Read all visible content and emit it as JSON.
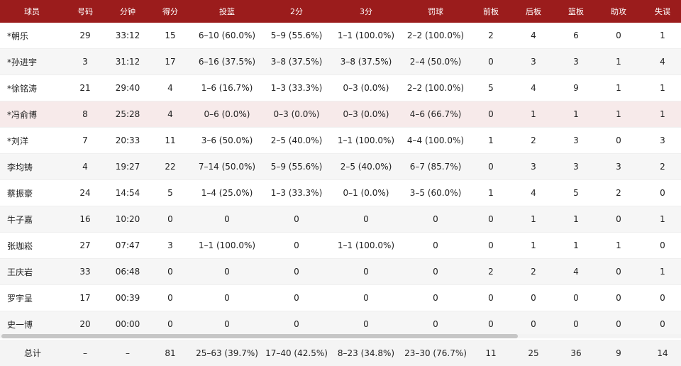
{
  "headers": [
    "球员",
    "号码",
    "分钟",
    "得分",
    "投篮",
    "2分",
    "3分",
    "罚球",
    "前板",
    "后板",
    "篮板",
    "助攻",
    "失误"
  ],
  "players": [
    {
      "name": "*朝乐",
      "number": "29",
      "minutes": "33:12",
      "points": "15",
      "fg": "6–10 (60.0%)",
      "two": "5–9 (55.6%)",
      "three": "1–1 (100.0%)",
      "ft": "2–2 (100.0%)",
      "oreb": "2",
      "dreb": "4",
      "reb": "6",
      "ast": "0",
      "tov": "1"
    },
    {
      "name": "*孙进宇",
      "number": "3",
      "minutes": "31:12",
      "points": "17",
      "fg": "6–16 (37.5%)",
      "two": "3–8 (37.5%)",
      "three": "3–8 (37.5%)",
      "ft": "2–4 (50.0%)",
      "oreb": "0",
      "dreb": "3",
      "reb": "3",
      "ast": "1",
      "tov": "4"
    },
    {
      "name": "*徐铭涛",
      "number": "21",
      "minutes": "29:40",
      "points": "4",
      "fg": "1–6 (16.7%)",
      "two": "1–3 (33.3%)",
      "three": "0–3 (0.0%)",
      "ft": "2–2 (100.0%)",
      "oreb": "5",
      "dreb": "4",
      "reb": "9",
      "ast": "1",
      "tov": "1"
    },
    {
      "name": "*冯俞博",
      "number": "8",
      "minutes": "25:28",
      "points": "4",
      "fg": "0–6 (0.0%)",
      "two": "0–3 (0.0%)",
      "three": "0–3 (0.0%)",
      "ft": "4–6 (66.7%)",
      "oreb": "0",
      "dreb": "1",
      "reb": "1",
      "ast": "1",
      "tov": "1"
    },
    {
      "name": "*刘洋",
      "number": "7",
      "minutes": "20:33",
      "points": "11",
      "fg": "3–6 (50.0%)",
      "two": "2–5 (40.0%)",
      "three": "1–1 (100.0%)",
      "ft": "4–4 (100.0%)",
      "oreb": "1",
      "dreb": "2",
      "reb": "3",
      "ast": "0",
      "tov": "3"
    },
    {
      "name": "李均铸",
      "number": "4",
      "minutes": "19:27",
      "points": "22",
      "fg": "7–14 (50.0%)",
      "two": "5–9 (55.6%)",
      "three": "2–5 (40.0%)",
      "ft": "6–7 (85.7%)",
      "oreb": "0",
      "dreb": "3",
      "reb": "3",
      "ast": "3",
      "tov": "2"
    },
    {
      "name": "蔡振豪",
      "number": "24",
      "minutes": "14:54",
      "points": "5",
      "fg": "1–4 (25.0%)",
      "two": "1–3 (33.3%)",
      "three": "0–1 (0.0%)",
      "ft": "3–5 (60.0%)",
      "oreb": "1",
      "dreb": "4",
      "reb": "5",
      "ast": "2",
      "tov": "0"
    },
    {
      "name": "牛子嘉",
      "number": "16",
      "minutes": "10:20",
      "points": "0",
      "fg": "0",
      "two": "0",
      "three": "0",
      "ft": "0",
      "oreb": "0",
      "dreb": "1",
      "reb": "1",
      "ast": "0",
      "tov": "1"
    },
    {
      "name": "张珈崧",
      "number": "27",
      "minutes": "07:47",
      "points": "3",
      "fg": "1–1 (100.0%)",
      "two": "0",
      "three": "1–1 (100.0%)",
      "ft": "0",
      "oreb": "0",
      "dreb": "1",
      "reb": "1",
      "ast": "1",
      "tov": "0"
    },
    {
      "name": "王庆岩",
      "number": "33",
      "minutes": "06:48",
      "points": "0",
      "fg": "0",
      "two": "0",
      "three": "0",
      "ft": "0",
      "oreb": "2",
      "dreb": "2",
      "reb": "4",
      "ast": "0",
      "tov": "1"
    },
    {
      "name": "罗宇呈",
      "number": "17",
      "minutes": "00:39",
      "points": "0",
      "fg": "0",
      "two": "0",
      "three": "0",
      "ft": "0",
      "oreb": "0",
      "dreb": "0",
      "reb": "0",
      "ast": "0",
      "tov": "0"
    },
    {
      "name": "史一博",
      "number": "20",
      "minutes": "00:00",
      "points": "0",
      "fg": "0",
      "two": "0",
      "three": "0",
      "ft": "0",
      "oreb": "0",
      "dreb": "0",
      "reb": "0",
      "ast": "0",
      "tov": "0"
    }
  ],
  "totals": {
    "name": "总计",
    "number": "–",
    "minutes": "–",
    "points": "81",
    "fg": "25–63 (39.7%)",
    "two": "17–40 (42.5%)",
    "three": "8–23 (34.8%)",
    "ft": "23–30 (76.7%)",
    "oreb": "11",
    "dreb": "25",
    "reb": "36",
    "ast": "9",
    "tov": "14"
  },
  "colors": {
    "header_bg": "#9b1c1c",
    "highlight_row": "#f7eaea"
  }
}
